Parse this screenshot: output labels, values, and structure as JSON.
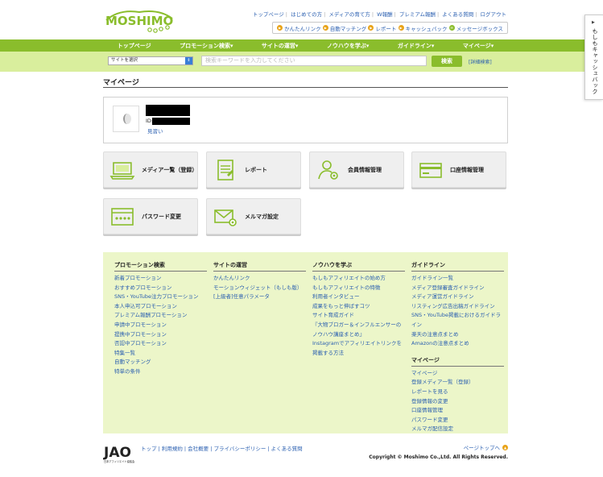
{
  "header": {
    "logo_text": "MOSHIMO",
    "top_links": [
      "トップページ",
      "はじめての方",
      "メディアの育て方",
      "W報酬",
      "プレミアム報酬",
      "よくある質問",
      "ログアウト"
    ],
    "sub_links": [
      "かんたんリンク",
      "自動マッチング",
      "レポート",
      "キャッシュバック",
      "メッセージボックス"
    ]
  },
  "nav": {
    "items": [
      "トップページ",
      "プロモーション検索▾",
      "サイトの運営▾",
      "ノウハウを学ぶ▾",
      "ガイドライン▾",
      "マイページ▾"
    ]
  },
  "search": {
    "select_value": "サイトを選択",
    "placeholder": "検索キーワードを入力してください",
    "button": "検索",
    "advanced": "[詳細検索]"
  },
  "side_tab": {
    "label": "もしもキャッシュバック"
  },
  "page": {
    "title": "マイページ",
    "id_label": "ID:",
    "mimai_link": "見習い"
  },
  "cards": [
    "メディア一覧（登録）",
    "レポート",
    "会員情報管理",
    "口座情報管理",
    "パスワード変更",
    "メルマガ設定"
  ],
  "footer": {
    "col1": {
      "title": "プロモーション検索",
      "links": [
        "新着プロモーション",
        "おすすめプロモーション",
        "SNS・YouTube注力プロモーション",
        "本人申込可プロモーション",
        "プレミアム報酬プロモーション",
        "申請中プロモーション",
        "提携中プロモーション",
        "否認中プロモーション",
        "特集一覧",
        "自動マッチング",
        "特単の条件"
      ]
    },
    "col2": {
      "title": "サイトの運営",
      "links": [
        "かんたんリンク",
        "モーションウィジェット（もしも版）",
        "[上級者]任意パラメータ"
      ]
    },
    "col3": {
      "title": "ノウハウを学ぶ",
      "links": [
        "もしもアフィリエイトの始め方",
        "もしもアフィリエイトの特徴",
        "利用者インタビュー",
        "成果をもっと伸ばすコツ",
        "サイト育成ガイド",
        "『大物ブロガー＆インフルエンサーの",
        "ノウハウ講座まとめ』",
        "Instagramでアフィリエイトリンクを",
        "掲載する方法"
      ]
    },
    "col4": {
      "title": "ガイドライン",
      "links": [
        "ガイドライン一覧",
        "メディア登録審査ガイドライン",
        "メディア運営ガイドライン",
        "リスティング広告出稿ガイドライン",
        "SNS・YouTube掲載におけるガイドラ",
        "イン",
        "楽天の注意点まとめ",
        "Amazonの注意点まとめ"
      ],
      "title2": "マイページ",
      "links2": [
        "マイページ",
        "登録メディア一覧（登録）",
        "レポートを見る",
        "登録情報の変更",
        "口座情報管理",
        "パスワード変更",
        "メルマガ配信設定"
      ]
    }
  },
  "bottom": {
    "jao_text": "JAO",
    "jao_sub": "日本アフィリエイト協議会",
    "links": "トップ | 利用規約 | 会社概要 | プライバシーポリシー | よくある質問",
    "page_top": "ページトップへ",
    "copyright": "Copyright © Moshimo Co.,Ltd. All Rights Reserved."
  },
  "colors": {
    "brand_green": "#8abd2c",
    "light_green": "#d9ee9d",
    "footer_bg": "#ecf6c9",
    "link_blue": "#2a5fb0"
  }
}
